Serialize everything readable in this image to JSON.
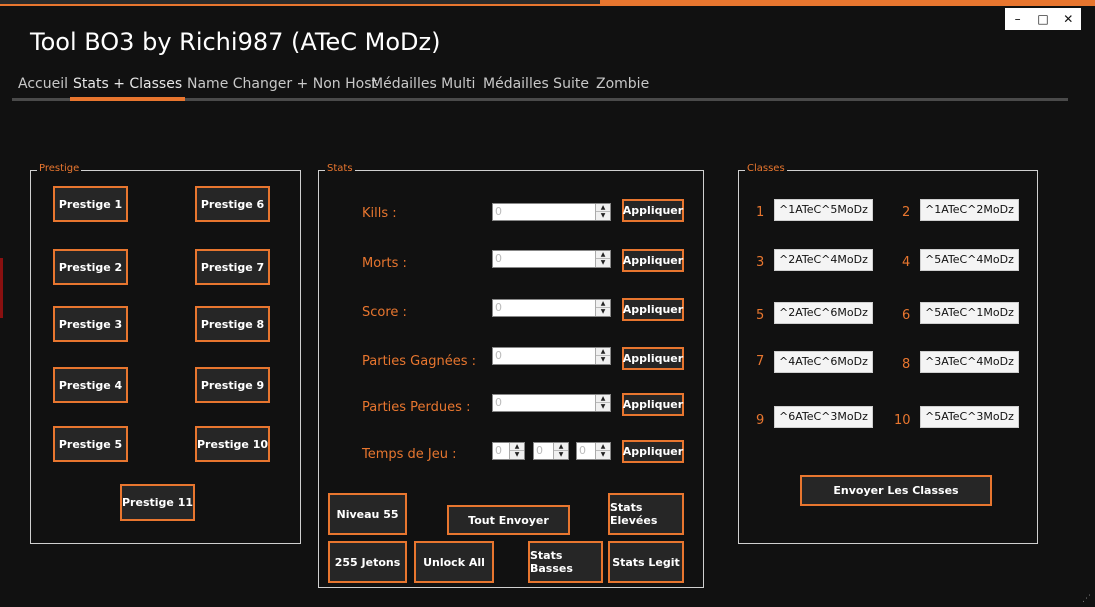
{
  "window": {
    "title": "Tool BO3 by Richi987 (ATeC MoDz)",
    "controls": {
      "minimize": "–",
      "maximize": "□",
      "close": "✕"
    }
  },
  "tabs": [
    {
      "label": "Accueil"
    },
    {
      "label": "Stats + Classes",
      "active": true
    },
    {
      "label": "Name Changer + Non Host"
    },
    {
      "label": "Médailles Multi"
    },
    {
      "label": "Médailles Suite"
    },
    {
      "label": "Zombie"
    }
  ],
  "prestige": {
    "legend": "Prestige",
    "buttons": [
      "Prestige 1",
      "Prestige 6",
      "Prestige 2",
      "Prestige 7",
      "Prestige 3",
      "Prestige 8",
      "Prestige 4",
      "Prestige 9",
      "Prestige 5",
      "Prestige 10",
      "Prestige 11"
    ]
  },
  "stats": {
    "legend": "Stats",
    "rows": [
      {
        "label": "Kills :",
        "value": "0",
        "apply": "Appliquer"
      },
      {
        "label": "Morts :",
        "value": "0",
        "apply": "Appliquer"
      },
      {
        "label": "Score :",
        "value": "0",
        "apply": "Appliquer"
      },
      {
        "label": "Parties Gagnées :",
        "value": "0",
        "apply": "Appliquer"
      },
      {
        "label": "Parties Perdues :",
        "value": "0",
        "apply": "Appliquer"
      }
    ],
    "playtime": {
      "label": "Temps de Jeu :",
      "values": [
        "0",
        "0",
        "0"
      ],
      "apply": "Appliquer"
    },
    "actions": {
      "niveau": "Niveau 55",
      "tout_envoyer": "Tout Envoyer",
      "stats_elevees": "Stats Elevées",
      "jetons": "255 Jetons",
      "unlock_all": "Unlock All",
      "stats_basses": "Stats Basses",
      "stats_legit": "Stats Legit"
    }
  },
  "classes": {
    "legend": "Classes",
    "items": [
      {
        "num": "1",
        "value": "^1ATeC^5MoDz"
      },
      {
        "num": "2",
        "value": "^1ATeC^2MoDz"
      },
      {
        "num": "3",
        "value": "^2ATeC^4MoDz"
      },
      {
        "num": "4",
        "value": "^5ATeC^4MoDz"
      },
      {
        "num": "5",
        "value": "^2ATeC^6MoDz"
      },
      {
        "num": "6",
        "value": "^5ATeC^1MoDz"
      },
      {
        "num": "7",
        "value": "^4ATeC^6MoDz"
      },
      {
        "num": "8",
        "value": "^3ATeC^4MoDz"
      },
      {
        "num": "9",
        "value": "^6ATeC^3MoDz"
      },
      {
        "num": "10",
        "value": "^5ATeC^3MoDz"
      }
    ],
    "send": "Envoyer Les Classes"
  },
  "colors": {
    "accent": "#e8762f",
    "background": "#111111",
    "button_bg": "#262626"
  },
  "icons": {
    "grip": "resize-grip-icon",
    "spin_up": "arrow-up-icon",
    "spin_down": "arrow-down-icon"
  }
}
